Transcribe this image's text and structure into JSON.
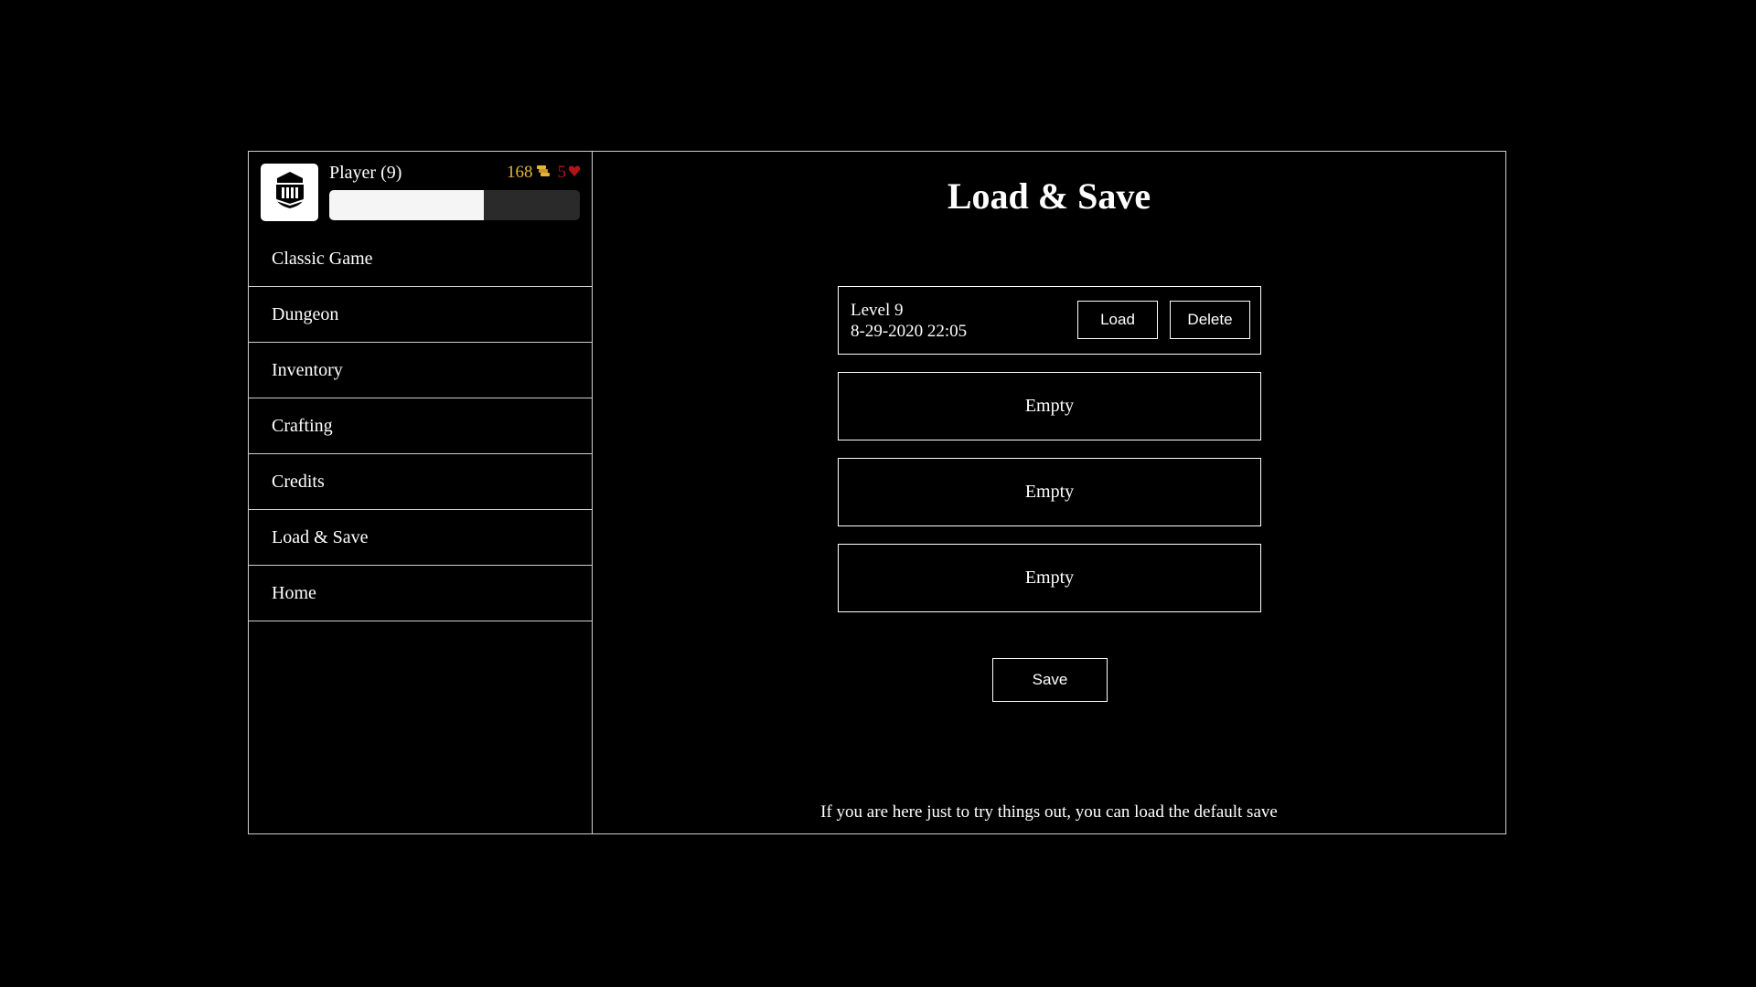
{
  "player": {
    "name": "Player (9)",
    "gold": "168",
    "hearts": "5",
    "xp_fraction": 0.615,
    "gold_color": "#e3b33a",
    "hearts_color": "#b3141c",
    "avatar_icon": "knight-helmet-icon",
    "gold_icon": "coins-icon",
    "hearts_icon": "heart-icon"
  },
  "sidebar": {
    "items": [
      {
        "label": "Classic Game"
      },
      {
        "label": "Dungeon"
      },
      {
        "label": "Inventory"
      },
      {
        "label": "Crafting"
      },
      {
        "label": "Credits"
      },
      {
        "label": "Load & Save"
      },
      {
        "label": "Home"
      }
    ]
  },
  "main": {
    "title": "Load & Save",
    "slots": [
      {
        "level": "Level 9",
        "date": "8-29-2020 22:05",
        "load_label": "Load",
        "delete_label": "Delete"
      },
      {
        "empty_label": "Empty"
      },
      {
        "empty_label": "Empty"
      },
      {
        "empty_label": "Empty"
      }
    ],
    "save_label": "Save",
    "hint": "If you are here just to try things out, you can load the default save"
  }
}
